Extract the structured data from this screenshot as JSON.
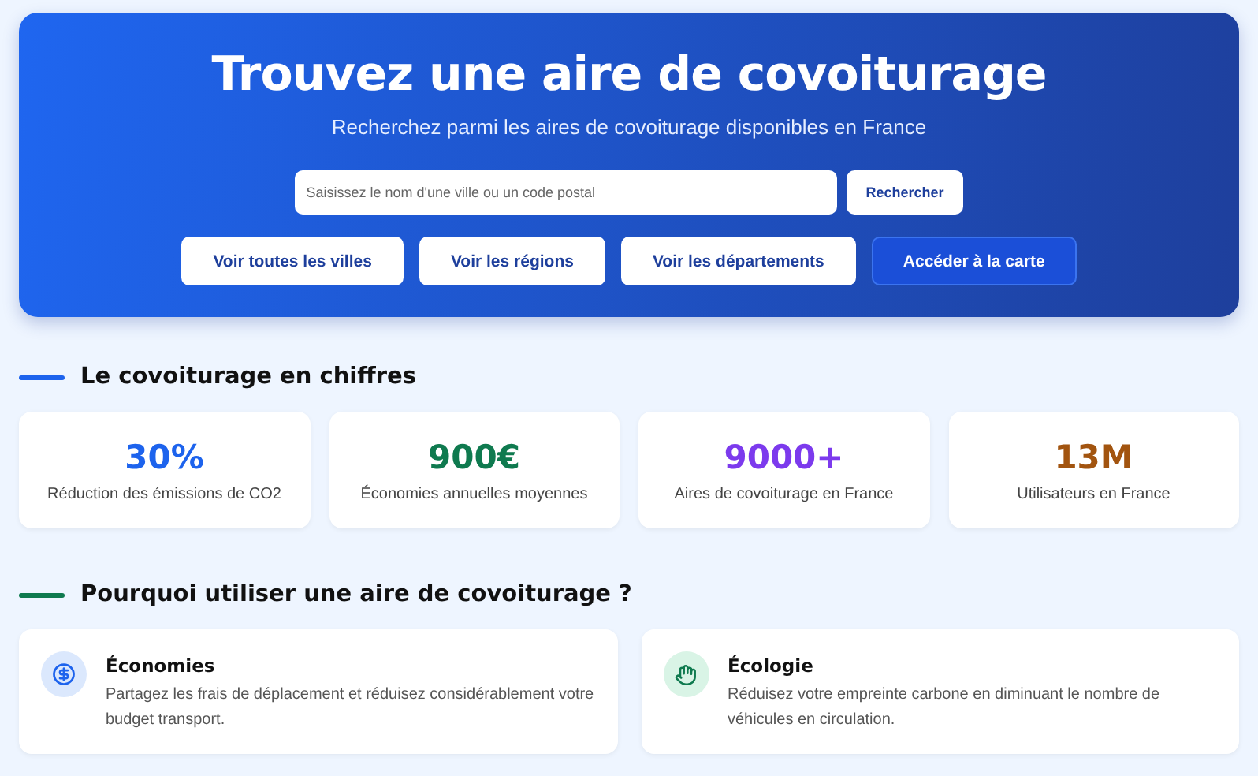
{
  "hero": {
    "title": "Trouvez une aire de covoiturage",
    "subtitle": "Recherchez parmi les aires de covoiturage disponibles en France",
    "search": {
      "placeholder": "Saisissez le nom d'une ville ou un code postal",
      "button": "Rechercher"
    },
    "links": [
      {
        "label": "Voir toutes les villes",
        "kind": "light"
      },
      {
        "label": "Voir les régions",
        "kind": "light"
      },
      {
        "label": "Voir les départements",
        "kind": "light"
      },
      {
        "label": "Accéder à la carte",
        "kind": "primary"
      }
    ]
  },
  "stats_section": {
    "title": "Le covoiturage en chiffres",
    "color": "#1d63ed",
    "stats": [
      {
        "value": "30%",
        "label": "Réduction des émissions de CO2",
        "color": "#1d63ed"
      },
      {
        "value": "900€",
        "label": "Économies annuelles moyennes",
        "color": "#0f7a4f"
      },
      {
        "value": "9000+",
        "label": "Aires de covoiturage en France",
        "color": "#7c3aed"
      },
      {
        "value": "13M",
        "label": "Utilisateurs en France",
        "color": "#a2540f"
      }
    ]
  },
  "why_section": {
    "title": "Pourquoi utiliser une aire de covoiturage ?",
    "color": "#0f7a4f",
    "features": [
      {
        "kind": "money",
        "title": "Économies",
        "text": "Partagez les frais de déplacement et réduisez considérablement votre budget transport."
      },
      {
        "kind": "hand",
        "title": "Écologie",
        "text": "Réduisez votre empreinte carbone en diminuant le nombre de véhicules en circulation."
      }
    ]
  }
}
